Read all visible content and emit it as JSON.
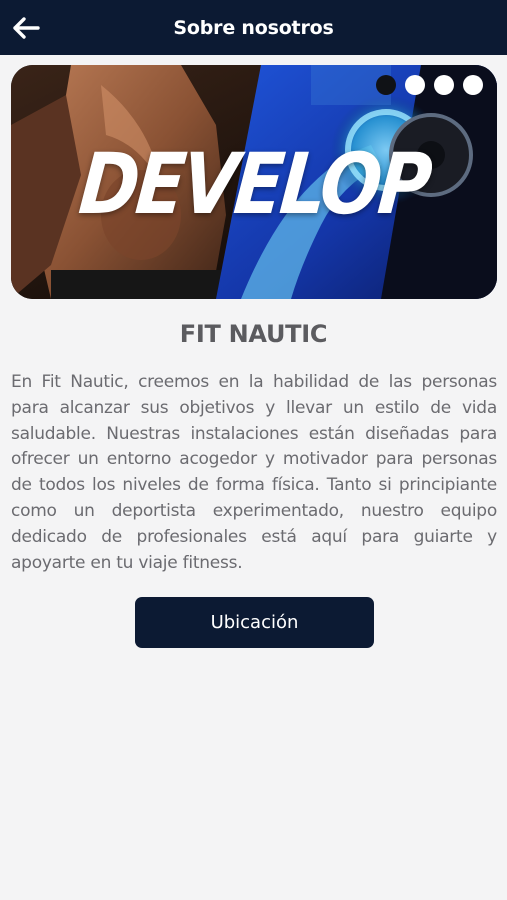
{
  "appbar": {
    "title": "Sobre nosotros",
    "back_icon": "arrow-left-icon"
  },
  "banner": {
    "word": "DEVELOP",
    "indicators": [
      {
        "state": "active"
      },
      {
        "state": "inactive"
      },
      {
        "state": "inactive"
      },
      {
        "state": "inactive"
      }
    ]
  },
  "content": {
    "title": "FIT NAUTIC",
    "description": "En Fit Nautic, creemos en la habilidad de las personas para alcanzar sus objetivos y llevar un estilo de vida saludable. Nuestras instalaciones están diseñadas para ofrecer un entorno acogedor y motivador para personas de todos los niveles de forma física. Tanto si principiante como un deportista experimentado, nuestro equipo dedicado de profesionales está aquí para guiarte y apoyarte en tu viaje fitness.",
    "location_button": "Ubicación"
  },
  "colors": {
    "appbar": "#0c1a33",
    "background": "#f4f4f5",
    "button": "#0c1a33",
    "text": "#6b6b70"
  }
}
